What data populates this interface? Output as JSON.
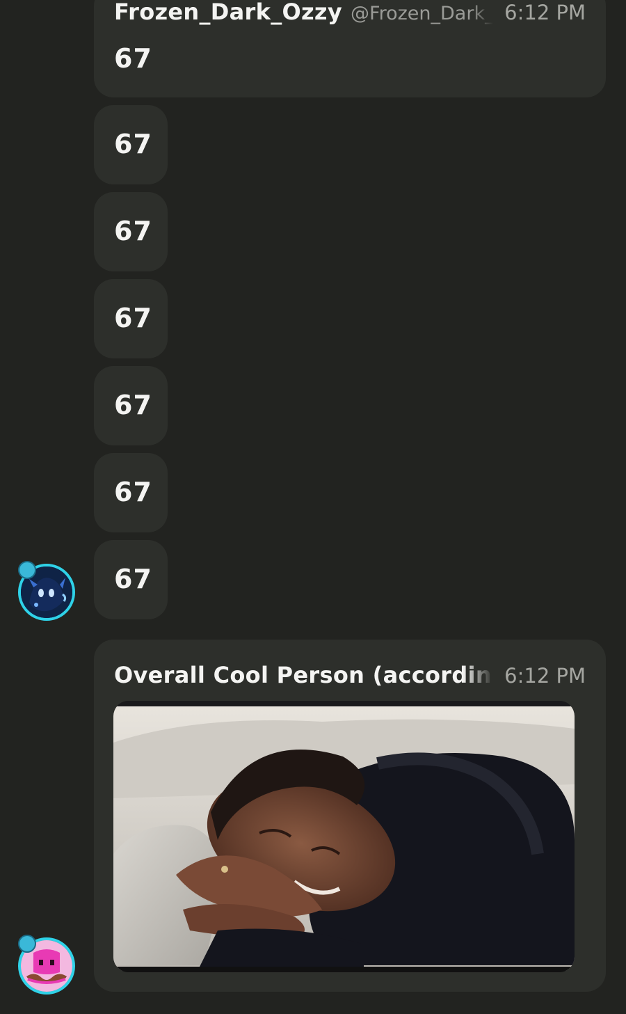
{
  "messages": {
    "first": {
      "display_name": "Frozen_Dark_Ozzy",
      "handle": "@Frozen_Dark_",
      "time": "6:12 PM",
      "text": "67"
    },
    "followups": [
      "67",
      "67",
      "67",
      "67",
      "67",
      "67"
    ],
    "second": {
      "display_name": "Overall Cool Person (according to",
      "time": "6:12 PM",
      "attachment_icon": "gif-image"
    }
  },
  "colors": {
    "background": "#222320",
    "bubble": "#2d2f2b",
    "avatar_ring": "#2fd2e8",
    "avatar1_fill": "#0f2346",
    "avatar2_fill": "#e040b0"
  }
}
